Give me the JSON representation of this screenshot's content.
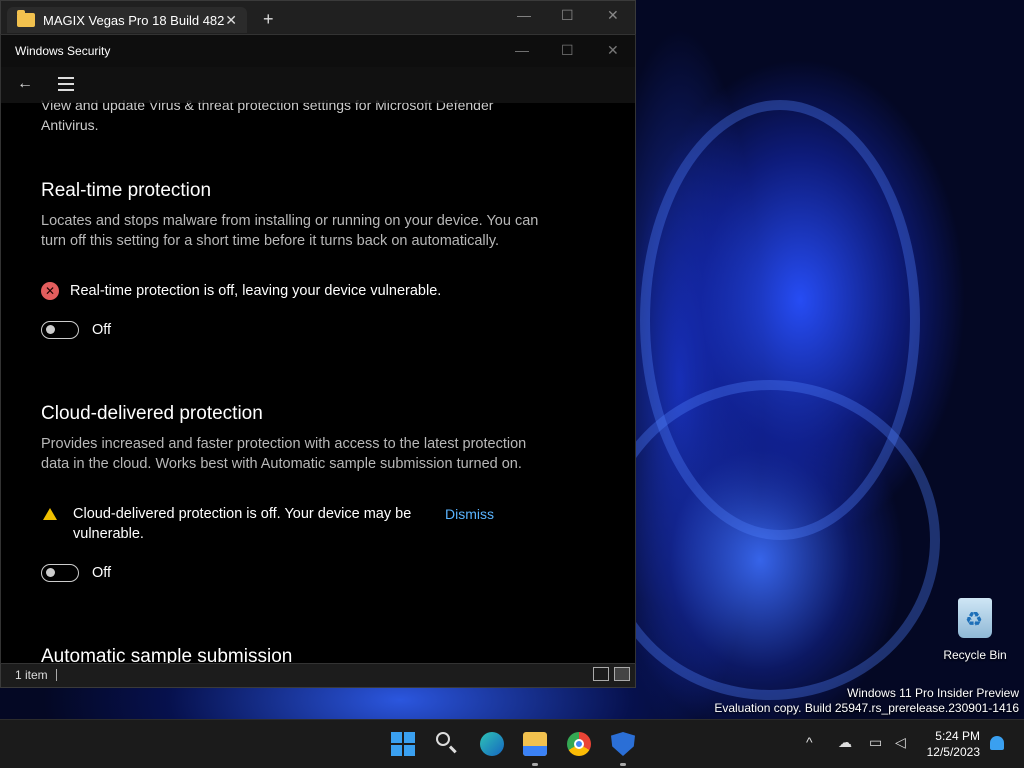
{
  "explorer": {
    "tab_title": "MAGIX Vegas Pro 18 Build 482",
    "close_glyph": "✕",
    "add_glyph": "+",
    "status_items": "1 item"
  },
  "security": {
    "title": "Windows Security",
    "intro_text": "View and update Virus & threat protection settings for Microsoft Defender Antivirus.",
    "sections": [
      {
        "heading": "Real-time protection",
        "description": "Locates and stops malware from installing or running on your device. You can turn off this setting for a short time before it turns back on automatically.",
        "alert": "Real-time protection is off, leaving your device vulnerable.",
        "toggle_label": "Off"
      },
      {
        "heading": "Cloud-delivered protection",
        "description": "Provides increased and faster protection with access to the latest protection data in the cloud. Works best with Automatic sample submission turned on.",
        "alert": "Cloud-delivered protection is off. Your device may be vulnerable.",
        "dismiss": "Dismiss",
        "toggle_label": "Off"
      },
      {
        "heading": "Automatic sample submission"
      }
    ]
  },
  "desktop": {
    "recycle_bin_label": "Recycle Bin",
    "watermark_line1": "Windows 11 Pro Insider Preview",
    "watermark_line2": "Evaluation copy. Build 25947.rs_prerelease.230901-1416"
  },
  "taskbar": {
    "time": "5:24 PM",
    "date": "12/5/2023",
    "icons": [
      "start-icon",
      "search-icon",
      "edge-icon",
      "explorer-icon",
      "chrome-icon",
      "defender-icon"
    ]
  },
  "colors": {
    "accent": "#5ab4ff",
    "error": "#e35d5d",
    "warning": "#f0c000"
  }
}
